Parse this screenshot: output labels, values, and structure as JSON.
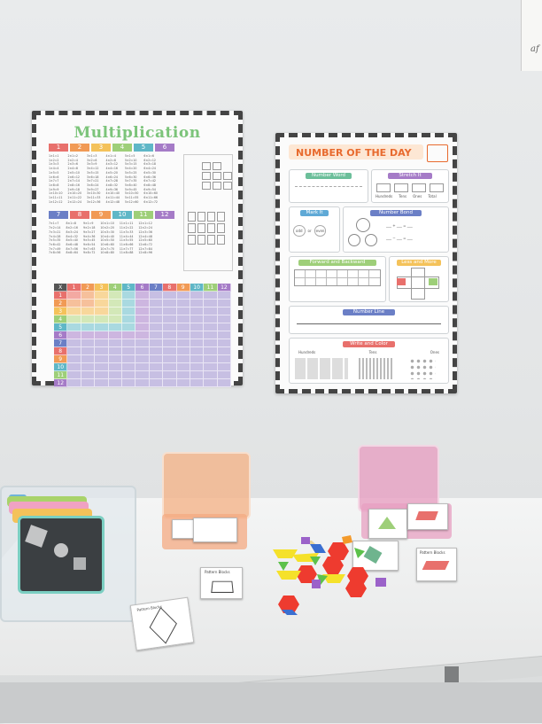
{
  "wall_texts": {
    "edge_corner": "af"
  },
  "multiplication_poster": {
    "title": "Multiplication",
    "column_numbers": [
      "1",
      "2",
      "3",
      "4",
      "5",
      "6",
      "7",
      "8",
      "9",
      "10",
      "11",
      "12"
    ],
    "grid_header": [
      "X",
      "1",
      "2",
      "3",
      "4",
      "5",
      "6",
      "7",
      "8",
      "9",
      "10",
      "11",
      "12"
    ],
    "grid_rows": [
      "1",
      "2",
      "3",
      "4",
      "5",
      "6",
      "7",
      "8",
      "9",
      "10",
      "11",
      "12"
    ],
    "colors": [
      "#e8706c",
      "#f19a55",
      "#f4c25a",
      "#9ecf79",
      "#5fb7c7",
      "#a57bc7",
      "#6b7fc6",
      "#e8706c",
      "#f19a55",
      "#5fb7c7",
      "#9ecf79",
      "#a57bc7"
    ]
  },
  "number_of_day_poster": {
    "title": "NUMBER OF THE DAY",
    "sections": {
      "number_word": "Number Word",
      "stretch_it": "Stretch It",
      "mark_it": "Mark It",
      "number_bond": "Number Bond",
      "forward_backward": "Forward and Backward",
      "less_more": "Less and More",
      "number_line": "Number Line",
      "write_color": "Write and Color"
    },
    "labels": {
      "hundreds": "Hundreds",
      "tens": "Tens",
      "ones": "Ones",
      "total": "Total",
      "odd": "odd",
      "or": "or",
      "even": "even"
    }
  },
  "cards": {
    "pattern_blocks": "Pattern Blocks"
  },
  "colors": {
    "wall": "#e6e8e9",
    "table": "#eeefef",
    "orange_case": "#f4b48a",
    "pink_case": "#e7a0c2"
  }
}
